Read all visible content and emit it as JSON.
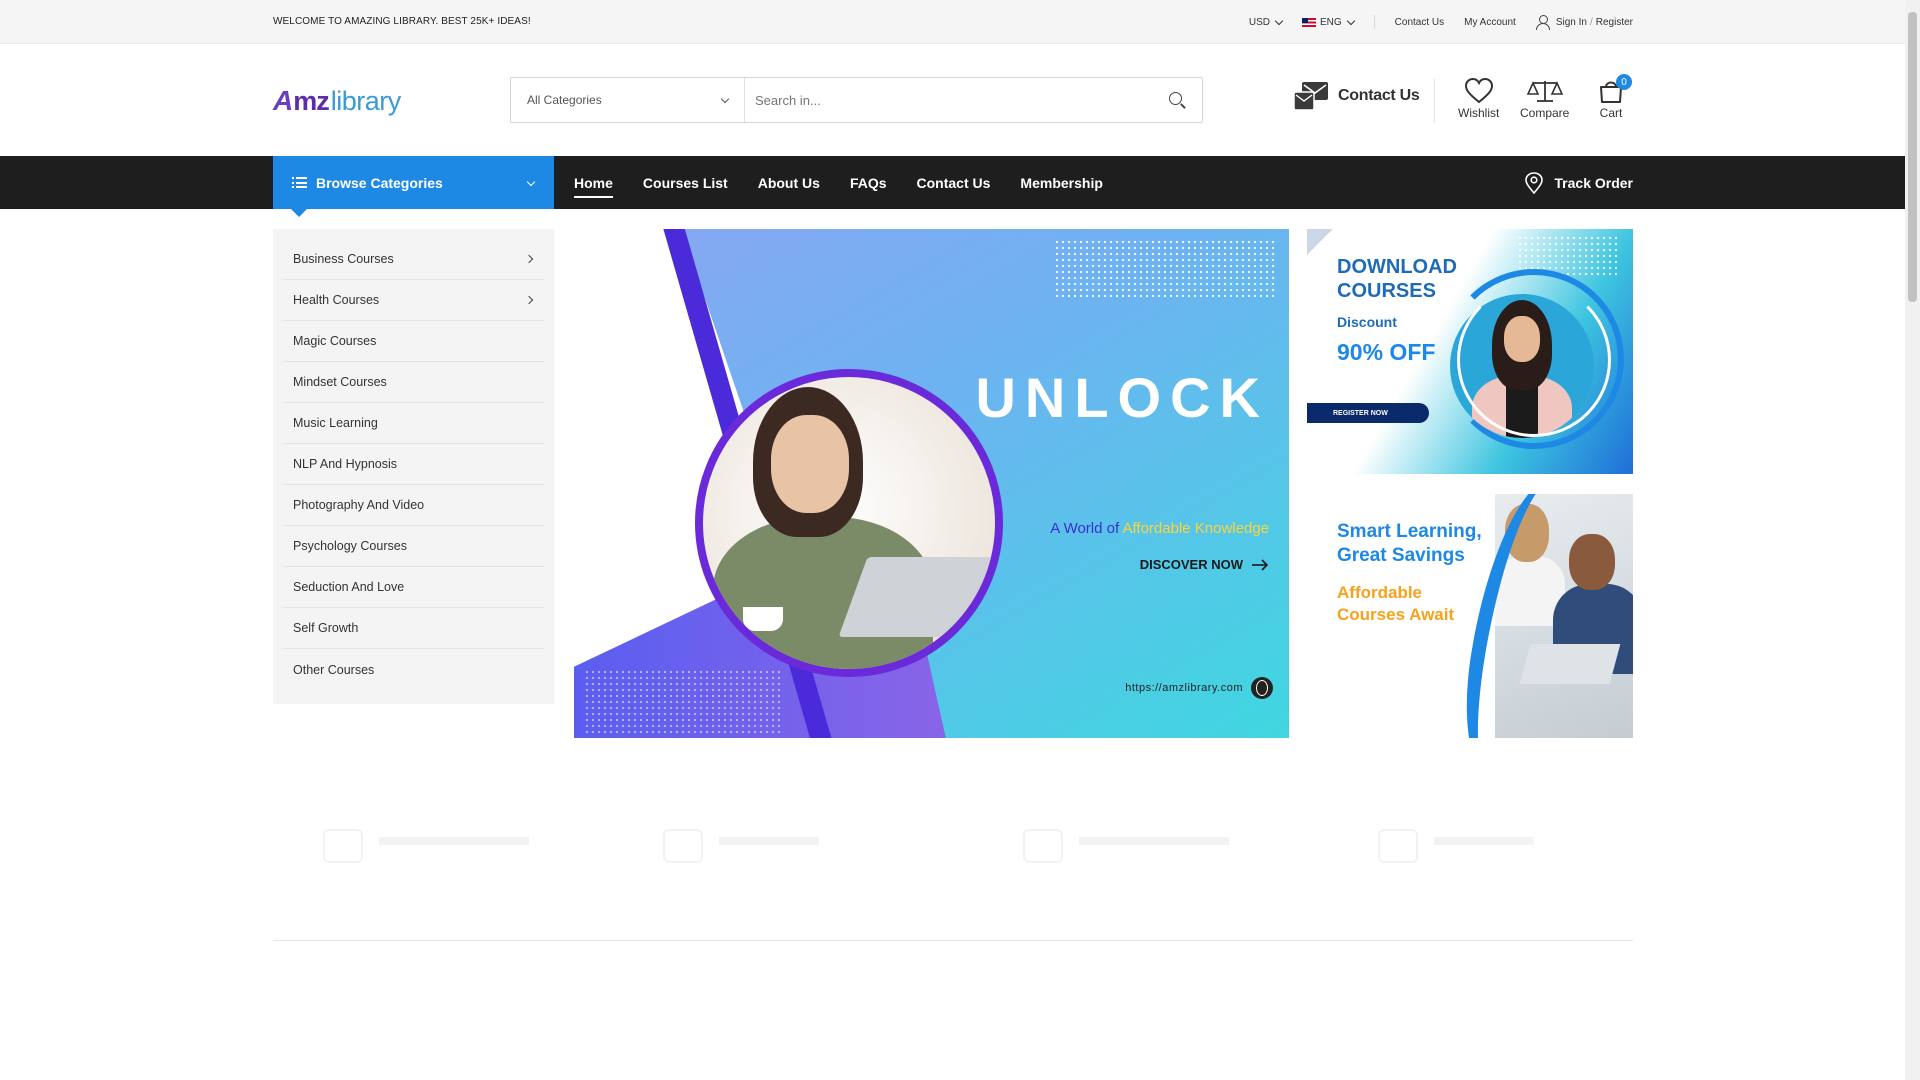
{
  "topbar": {
    "welcome": "WELCOME TO AMAZING LIBRARY. BEST 25K+ IDEAS!",
    "currency": "USD",
    "language": "ENG",
    "contact": "Contact Us",
    "account": "My Account",
    "sign_in": "Sign In",
    "slash": "/",
    "register": "Register"
  },
  "header": {
    "logo_a": "A",
    "logo_b": "mz",
    "logo_c": "library",
    "search_category": "All Categories",
    "search_placeholder": "Search in...",
    "contact": "Contact Us",
    "wishlist": "Wishlist",
    "compare": "Compare",
    "cart": "Cart",
    "cart_count": "0"
  },
  "nav": {
    "browse": "Browse Categories",
    "items": [
      "Home",
      "Courses List",
      "About Us",
      "FAQs",
      "Contact Us",
      "Membership"
    ],
    "active": "Home",
    "track": "Track Order"
  },
  "categories": [
    {
      "label": "Business Courses",
      "has_sub": true
    },
    {
      "label": "Health Courses",
      "has_sub": true
    },
    {
      "label": "Magic Courses",
      "has_sub": false
    },
    {
      "label": "Mindset Courses",
      "has_sub": false
    },
    {
      "label": "Music Learning",
      "has_sub": false
    },
    {
      "label": "NLP And Hypnosis",
      "has_sub": false
    },
    {
      "label": "Photography And Video",
      "has_sub": false
    },
    {
      "label": "Psychology Courses",
      "has_sub": false
    },
    {
      "label": "Seduction And Love",
      "has_sub": false
    },
    {
      "label": "Self Growth",
      "has_sub": false
    },
    {
      "label": "Other Courses",
      "has_sub": false
    }
  ],
  "hero": {
    "title": "UNLOCK",
    "sub_a": "A World of ",
    "sub_b": "Affordable Knowledge",
    "cta": "DISCOVER NOW",
    "url": "https://amzlibrary.com"
  },
  "banner1": {
    "line1": "DOWNLOAD",
    "line2": "COURSES",
    "discount": "Discount",
    "off": "90% OFF",
    "register": "REGISTER NOW"
  },
  "banner2": {
    "line1": "Smart Learning,",
    "line2": "Great Savings",
    "line3": "Affordable",
    "line4": "Courses Await"
  },
  "colors": {
    "accent": "#1e88e5",
    "nav_bg": "#1e1e1e",
    "topbar_bg": "#f5f5f5"
  }
}
